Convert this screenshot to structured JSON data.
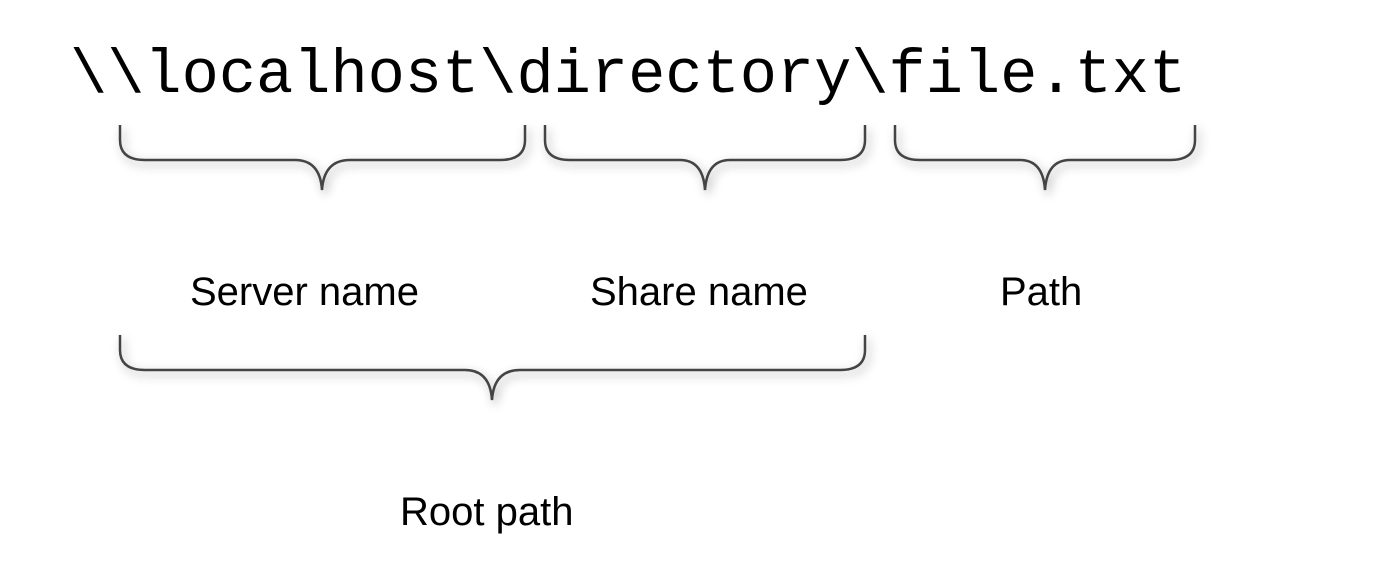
{
  "diagram": {
    "path": "\\\\localhost\\directory\\file.txt",
    "segments": {
      "server": {
        "text": "\\\\localhost",
        "label": "Server name"
      },
      "share": {
        "text": "\\directory",
        "label": "Share name"
      },
      "path": {
        "text": "\\file.txt",
        "label": "Path"
      },
      "root": {
        "text": "\\\\localhost\\directory",
        "label": "Root path"
      }
    }
  }
}
